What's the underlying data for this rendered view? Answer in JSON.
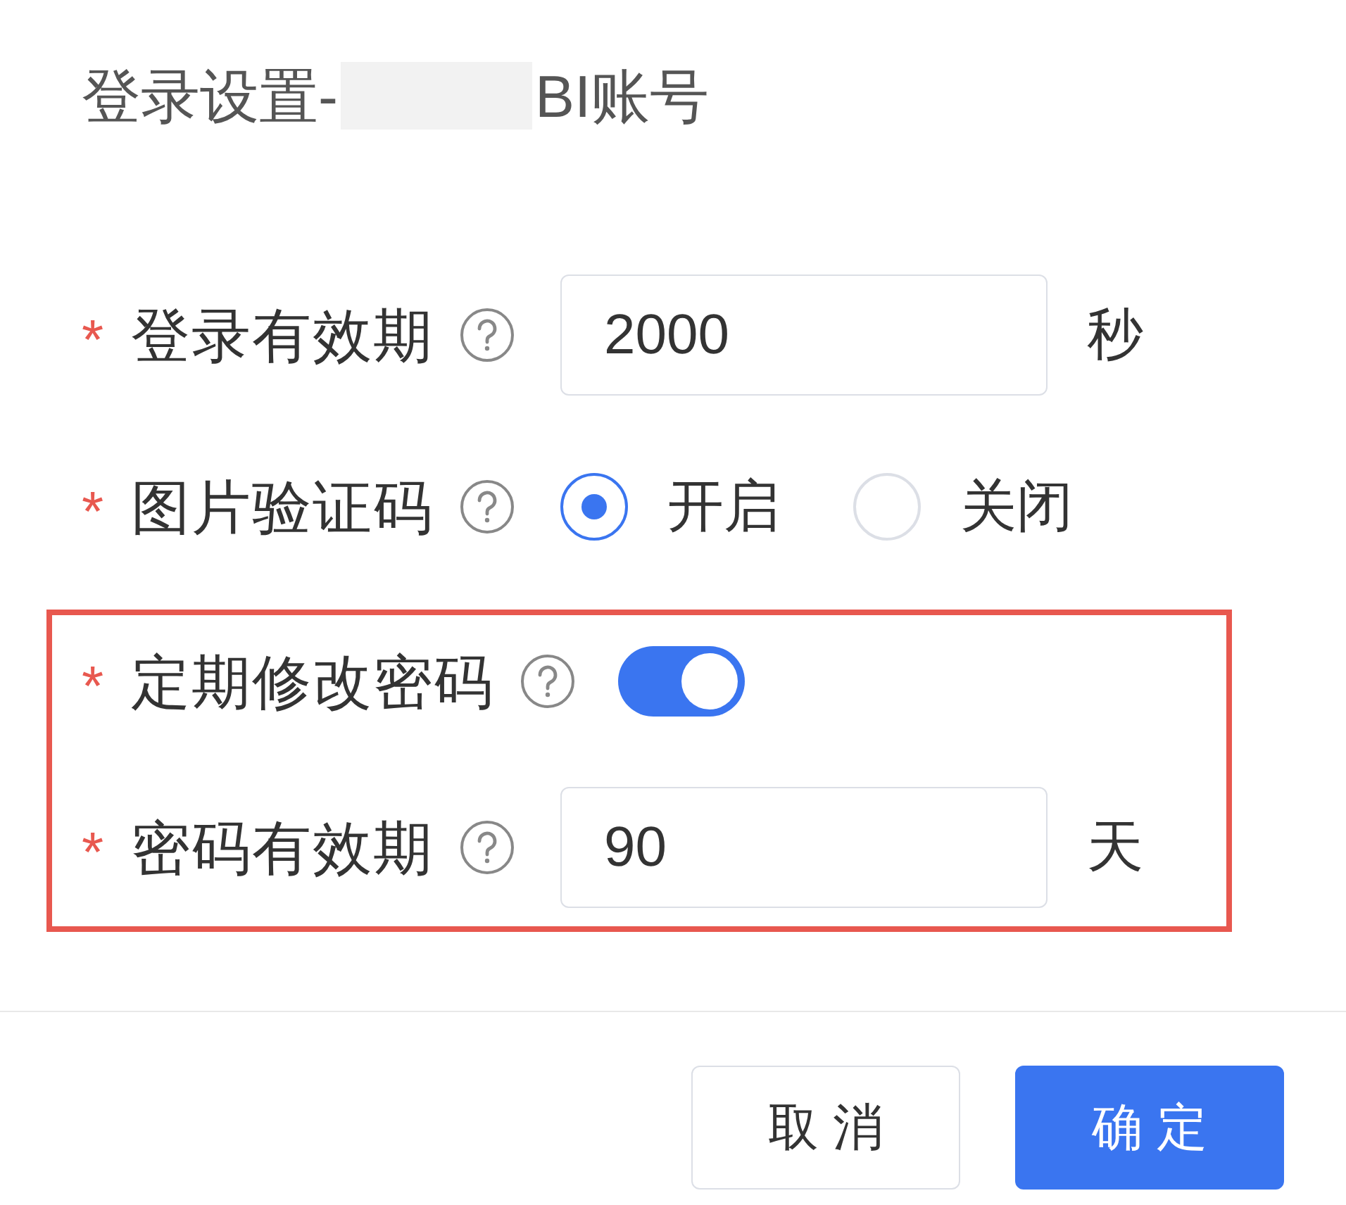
{
  "dialog": {
    "title_prefix": "登录设置-",
    "title_suffix": "BI账号"
  },
  "fields": [
    {
      "kind": "input",
      "required_mark": "*",
      "label": "登录有效期",
      "value": "2000",
      "unit": "秒"
    },
    {
      "kind": "radio",
      "required_mark": "*",
      "label": "图片验证码",
      "options": [
        {
          "label": "开启",
          "selected": true
        },
        {
          "label": "关闭",
          "selected": false
        }
      ]
    }
  ],
  "highlighted_fields": [
    {
      "kind": "switch",
      "required_mark": "*",
      "label": "定期修改密码",
      "on": true
    },
    {
      "kind": "input",
      "required_mark": "*",
      "label": "密码有效期",
      "value": "90",
      "unit": "天"
    }
  ],
  "buttons": [
    {
      "label": "取 消",
      "kind": "secondary"
    },
    {
      "label": "确 定",
      "kind": "primary"
    }
  ]
}
